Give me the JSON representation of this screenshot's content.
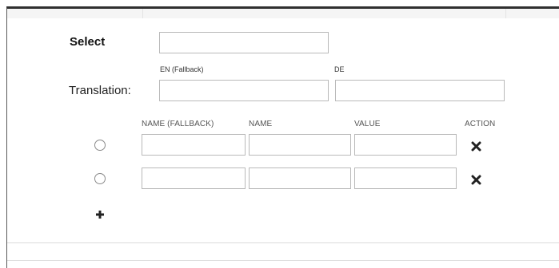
{
  "form": {
    "select_label": "Select",
    "select_value": "",
    "translation_label": "Translation:",
    "languages": [
      {
        "code": "EN (Fallback)",
        "value": ""
      },
      {
        "code": "DE",
        "value": ""
      }
    ]
  },
  "options_table": {
    "headers": {
      "name_fallback": "NAME (FALLBACK)",
      "name": "NAME",
      "value": "VALUE",
      "action": "ACTION"
    },
    "rows": [
      {
        "selected": false,
        "name_fallback": "",
        "name": "",
        "value": ""
      },
      {
        "selected": false,
        "name_fallback": "",
        "name": "",
        "value": ""
      }
    ],
    "row_action_icon": "x-remove-icon",
    "add_icon": "plus-icon"
  }
}
